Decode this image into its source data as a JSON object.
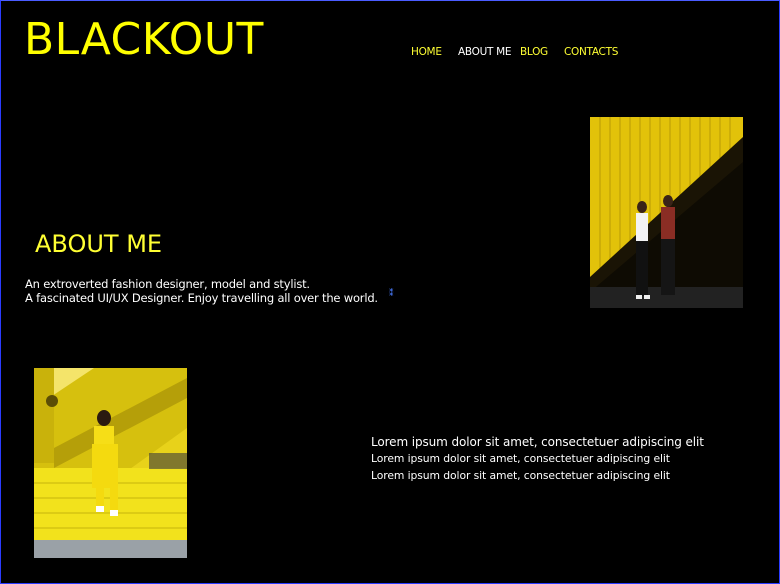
{
  "brand": {
    "name": "BLACKOUT"
  },
  "nav": {
    "items": [
      {
        "label": "HOME",
        "color": "#ffff33"
      },
      {
        "label": "ABOUT ME",
        "color": "#ffffff"
      },
      {
        "label": "BLOG",
        "color": "#ffff33"
      },
      {
        "label": "CONTACTS",
        "color": "#ffff33"
      }
    ]
  },
  "about": {
    "title": "ABOUT ME",
    "line1": "An extroverted fashion designer, model and stylist.",
    "line2": "A fascinated UI/UX Designer. Enjoy travelling all over the world."
  },
  "lorem": {
    "line1": "Lorem ipsum dolor sit amet, consectetuer adipiscing elit",
    "line2": "Lorem ipsum dolor sit amet, consectetuer adipiscing elit",
    "line3": "Lorem ipsum dolor sit amet, consectetuer adipiscing elit"
  },
  "colors": {
    "background": "#000000",
    "accent": "#ffff00",
    "text": "#ffffff"
  }
}
